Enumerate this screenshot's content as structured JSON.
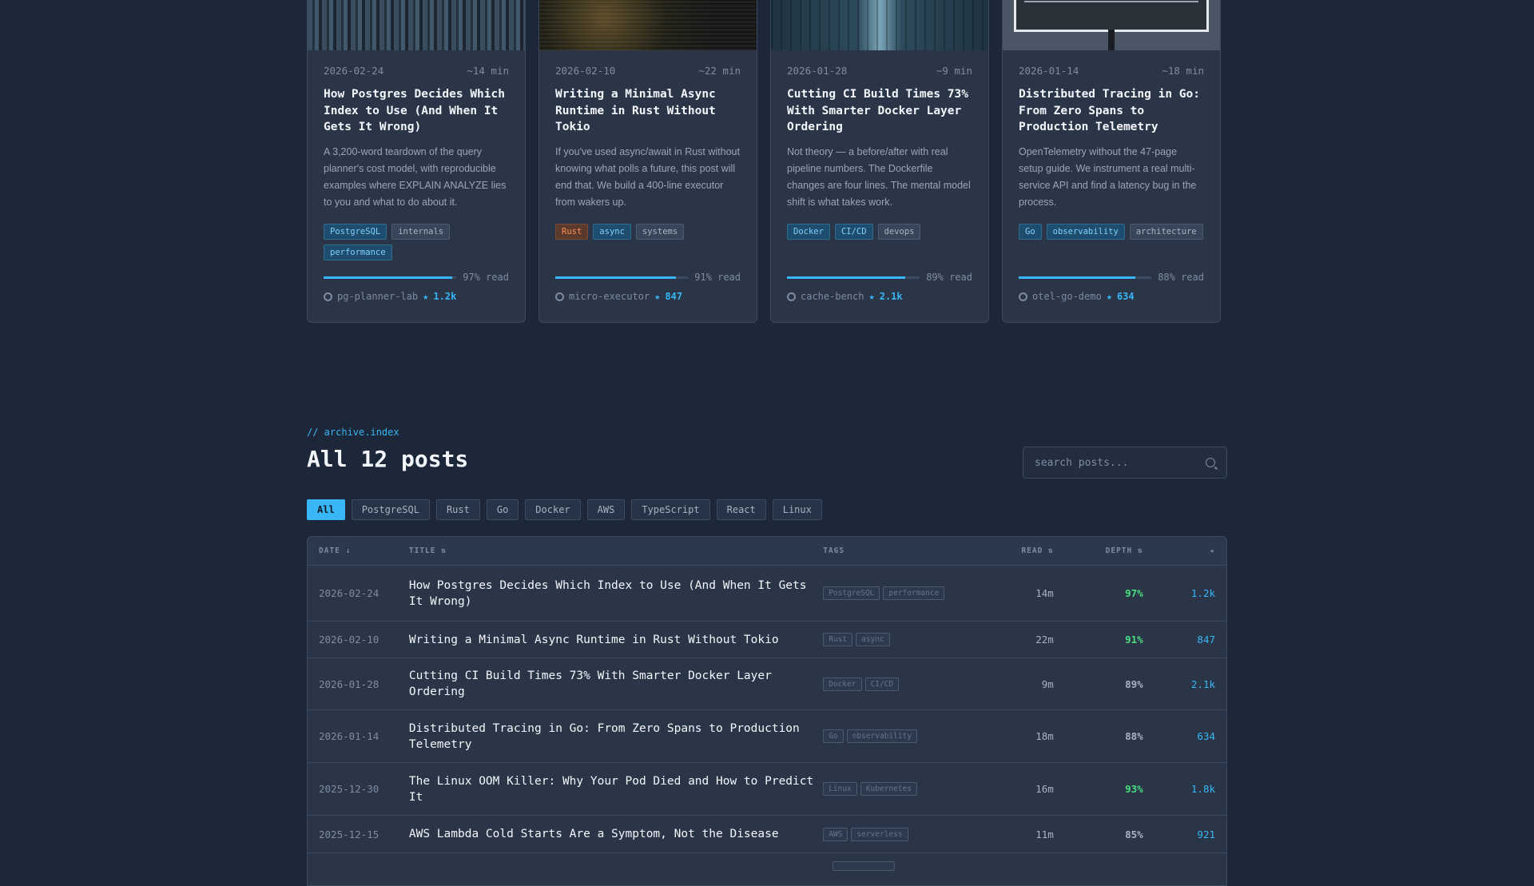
{
  "cards": [
    {
      "date": "2026-02-24",
      "time": "~14 min",
      "title": "How Postgres Decides Which Index to Use (And When It Gets It Wrong)",
      "desc": "A 3,200-word teardown of the query planner's cost model, with reproducible examples where EXPLAIN ANALYZE lies to you and what to do about it.",
      "tags": [
        "PostgreSQL",
        "internals",
        "performance"
      ],
      "read_pct": 97,
      "read_label": "97% read",
      "repo": "pg-planner-lab",
      "stars": "1.2k"
    },
    {
      "date": "2026-02-10",
      "time": "~22 min",
      "title": "Writing a Minimal Async Runtime in Rust Without Tokio",
      "desc": "If you've used async/await in Rust without knowing what polls a future, this post will end that. We build a 400-line executor from wakers up.",
      "tags": [
        "Rust",
        "async",
        "systems"
      ],
      "read_pct": 91,
      "read_label": "91% read",
      "repo": "micro-executor",
      "stars": "847"
    },
    {
      "date": "2026-01-28",
      "time": "~9 min",
      "title": "Cutting CI Build Times 73% With Smarter Docker Layer Ordering",
      "desc": "Not theory — a before/after with real pipeline numbers. The Dockerfile changes are four lines. The mental model shift is what takes work.",
      "tags": [
        "Docker",
        "CI/CD",
        "devops"
      ],
      "read_pct": 89,
      "read_label": "89% read",
      "repo": "cache-bench",
      "stars": "2.1k"
    },
    {
      "date": "2026-01-14",
      "time": "~18 min",
      "title": "Distributed Tracing in Go: From Zero Spans to Production Telemetry",
      "desc": "OpenTelemetry without the 47-page setup guide. We instrument a real multi-service API and find a latency bug in the process.",
      "tags": [
        "Go",
        "observability",
        "architecture"
      ],
      "read_pct": 88,
      "read_label": "88% read",
      "repo": "otel-go-demo",
      "stars": "634"
    }
  ],
  "archive": {
    "kicker": "// archive.index",
    "title": "All 12 posts",
    "search_placeholder": "search posts...",
    "filters": [
      "All",
      "PostgreSQL",
      "Rust",
      "Go",
      "Docker",
      "AWS",
      "TypeScript",
      "React",
      "Linux"
    ],
    "headers": {
      "date": "DATE ↓",
      "title": "TITLE ⇅",
      "tags": "TAGS",
      "read": "READ ⇅",
      "depth": "DEPTH ⇅",
      "stars": "★"
    },
    "rows": [
      {
        "date": "2026-02-24",
        "title": "How Postgres Decides Which Index to Use (And When It Gets It Wrong)",
        "tags": [
          "PostgreSQL",
          "performance"
        ],
        "read": "14m",
        "depth": "97%",
        "stars": "1.2k"
      },
      {
        "date": "2026-02-10",
        "title": "Writing a Minimal Async Runtime in Rust Without Tokio",
        "tags": [
          "Rust",
          "async"
        ],
        "read": "22m",
        "depth": "91%",
        "stars": "847"
      },
      {
        "date": "2026-01-28",
        "title": "Cutting CI Build Times 73% With Smarter Docker Layer Ordering",
        "tags": [
          "Docker",
          "CI/CD"
        ],
        "read": "9m",
        "depth": "89%",
        "stars": "2.1k"
      },
      {
        "date": "2026-01-14",
        "title": "Distributed Tracing in Go: From Zero Spans to Production Telemetry",
        "tags": [
          "Go",
          "observability"
        ],
        "read": "18m",
        "depth": "88%",
        "stars": "634"
      },
      {
        "date": "2025-12-30",
        "title": "The Linux OOM Killer: Why Your Pod Died and How to Predict It",
        "tags": [
          "Linux",
          "Kubernetes"
        ],
        "read": "16m",
        "depth": "93%",
        "stars": "1.8k"
      },
      {
        "date": "2025-12-15",
        "title": "AWS Lambda Cold Starts Are a Symptom, Not the Disease",
        "tags": [
          "AWS",
          "serverless"
        ],
        "read": "11m",
        "depth": "85%",
        "stars": "921"
      }
    ]
  },
  "colors": {
    "accent": "#38b6f5",
    "green": "#4ade80",
    "bg": "#1c2739"
  }
}
